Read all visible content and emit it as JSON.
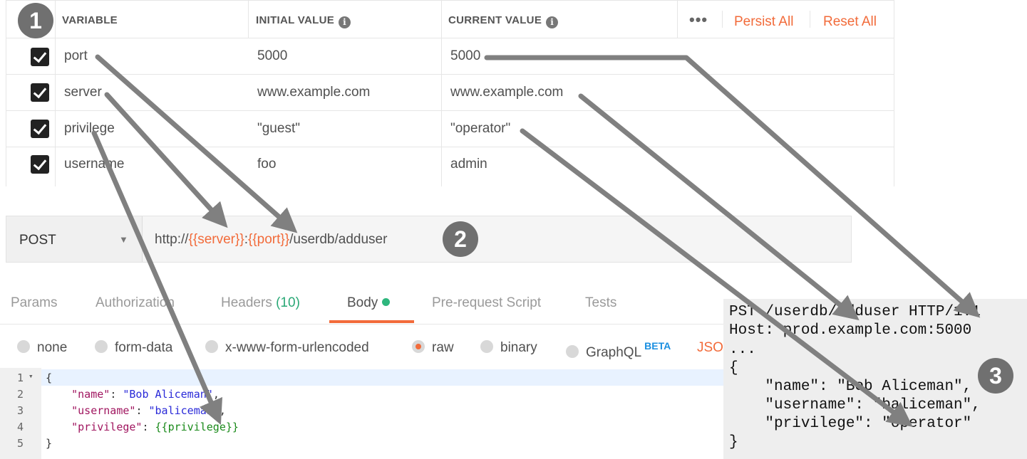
{
  "variables_table": {
    "columns": {
      "variable": "VARIABLE",
      "initial": "INITIAL VALUE",
      "current": "CURRENT VALUE"
    },
    "more_label": "•••",
    "persist_all": "Persist All",
    "reset_all": "Reset All",
    "rows": [
      {
        "name": "port",
        "initial": "5000",
        "current": "5000",
        "enabled": true
      },
      {
        "name": "server",
        "initial": "www.example.com",
        "current": "www.example.com",
        "enabled": true
      },
      {
        "name": "privilege",
        "initial": "\"guest\"",
        "current": "\"operator\"",
        "enabled": true
      },
      {
        "name": "username",
        "initial": "foo",
        "current": "admin",
        "enabled": true
      }
    ]
  },
  "badges": {
    "one": "1",
    "two": "2",
    "three": "3"
  },
  "request": {
    "method": "POST",
    "url_parts": {
      "scheme": "http://",
      "server": "{{server}}",
      "colon": ":",
      "port": "{{port}}",
      "path": "/userdb/adduser"
    }
  },
  "tabs": [
    {
      "label": "Params"
    },
    {
      "label": "Authorization"
    },
    {
      "label": "Headers",
      "count": "(10)"
    },
    {
      "label": "Body"
    },
    {
      "label": "Pre-request Script"
    },
    {
      "label": "Tests"
    }
  ],
  "body_types": {
    "options": [
      "none",
      "form-data",
      "x-www-form-urlencoded",
      "raw",
      "binary",
      "GraphQL"
    ],
    "selected": "raw",
    "beta": "BETA",
    "lang": "JSON"
  },
  "editor": {
    "line_numbers": [
      "1",
      "2",
      "3",
      "4",
      "5"
    ],
    "fold_marker": "▾",
    "open_brace": "{",
    "close_brace": "}",
    "lines": [
      {
        "key": "\"name\"",
        "value": "\"Bob Aliceman\"",
        "trail": ","
      },
      {
        "key": "\"username\"",
        "value": "\"baliceman\"",
        "trail": ","
      },
      {
        "key": "\"privilege\"",
        "value": "{{privilege}}",
        "trail": ""
      }
    ]
  },
  "raw_request": {
    "lines": [
      "PST /userdb/adduser HTTP/1.1",
      "Host: prod.example.com:5000",
      "...",
      "{",
      "    \"name\": \"Bob Aliceman\",",
      "    \"username\": \"baliceman\",",
      "    \"privilege\": \"operator\"",
      "}"
    ]
  },
  "colors": {
    "accent": "#f26b3a",
    "arrow": "#808080",
    "success": "#2eb67d",
    "beta": "#1a8fe0"
  }
}
